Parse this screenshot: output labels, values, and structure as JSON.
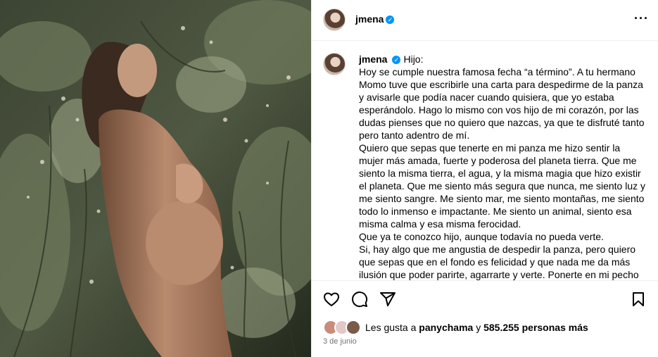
{
  "post": {
    "author": "jmena",
    "verified_mark": "✓",
    "more_icon": "more-horizontal-icon",
    "caption": [
      "Hijo:",
      "Hoy se cumple nuestra famosa fecha “a término”. A tu hermano Momo tuve que escribirle una carta para despedirme de la panza y avisarle que podía nacer cuando quisiera, que yo estaba esperándolo. Hago lo mismo con vos hijo de mi corazón, por las dudas pienses que no quiero que nazcas, ya que te disfruté tanto pero tanto adentro de mí.",
      "Quiero que sepas que tenerte en mi panza me hizo sentir la mujer más amada, fuerte y poderosa del planeta tierra. Que me siento la misma tierra, el agua, y la misma magia que hizo existir el planeta. Que me siento más segura que nunca, me siento luz y me siento sangre. Me siento mar, me siento montañas, me siento todo lo inmenso e impactante. Me siento un animal, siento esa misma calma y esa misma ferocidad.",
      "Que ya te conozco hijo, aunque todavía no pueda verte.",
      "Si, hay algo que me angustia de despedir la panza, pero quiero que sepas que en el fondo es felicidad y que nada me da más ilusión que poder parirte, agarrarte y verte. Ponerte en mi pecho"
    ],
    "likes": {
      "prefix": "Les gusta a",
      "user": "panychama",
      "connector": "y",
      "count": "585.255 personas más"
    },
    "date": "3 de junio"
  },
  "icons": {
    "like": "heart-icon",
    "comment": "comment-icon",
    "share": "send-icon",
    "save": "bookmark-icon"
  },
  "colors": {
    "verified": "#0095f6",
    "border": "#efefef",
    "muted": "#737373"
  }
}
